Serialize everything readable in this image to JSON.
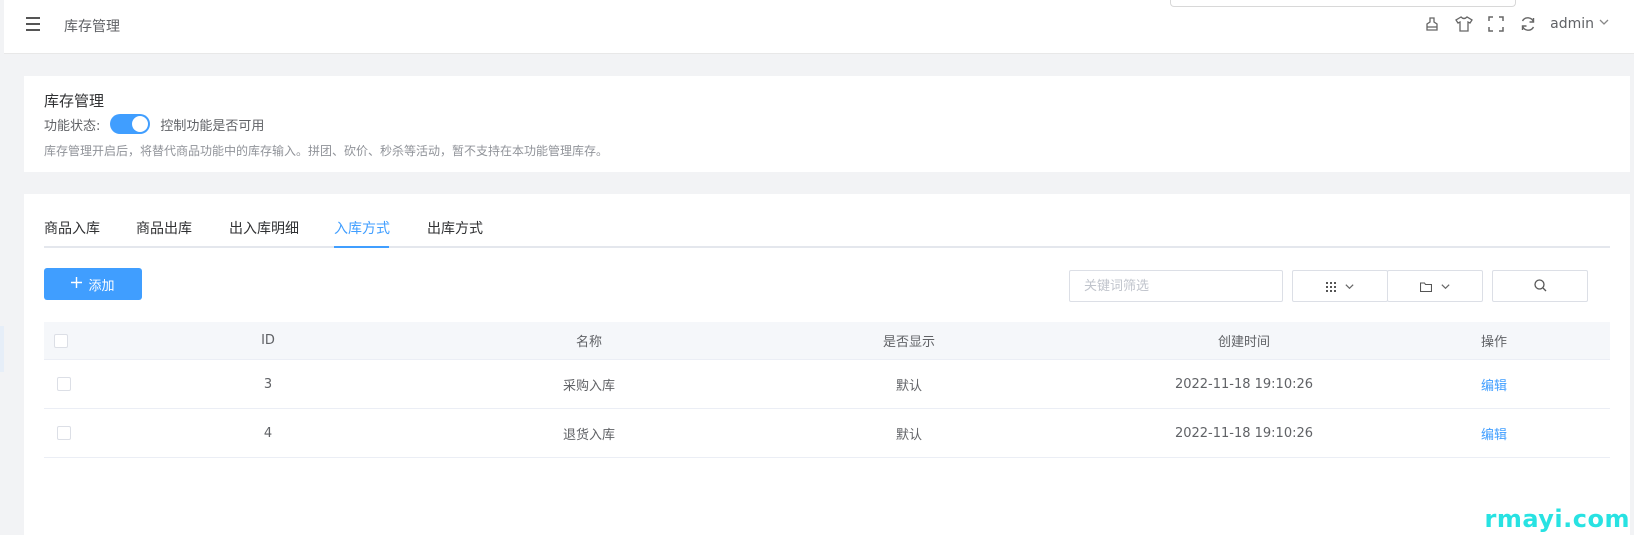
{
  "header": {
    "breadcrumb": "库存管理",
    "user": "admin",
    "icons": [
      "clean-icon",
      "shirt-icon",
      "fullscreen-icon",
      "refresh-icon",
      "chevron-down-icon"
    ]
  },
  "stock_card": {
    "title": "库存管理",
    "status_label": "功能状态:",
    "switch_on": true,
    "switch_desc": "控制功能是否可用",
    "note": "库存管理开启后，将替代商品功能中的库存输入。拼团、砍价、秒杀等活动，暂不支持在本功能管理库存。"
  },
  "tabs": [
    {
      "label": "商品入库",
      "active": false
    },
    {
      "label": "商品出库",
      "active": false
    },
    {
      "label": "出入库明细",
      "active": false
    },
    {
      "label": "入库方式",
      "active": true
    },
    {
      "label": "出库方式",
      "active": false
    }
  ],
  "toolbar": {
    "add_label": "添加",
    "search_placeholder": "关键词筛选"
  },
  "table": {
    "columns": [
      "ID",
      "名称",
      "是否显示",
      "创建时间",
      "操作"
    ],
    "rows": [
      {
        "id": "3",
        "name": "采购入库",
        "show": "默认",
        "created": "2022-11-18 19:10:26",
        "action": "编辑"
      },
      {
        "id": "4",
        "name": "退货入库",
        "show": "默认",
        "created": "2022-11-18 19:10:26",
        "action": "编辑"
      }
    ]
  },
  "watermark": "rmayi.com",
  "colors": {
    "primary": "#409eff",
    "background": "#f2f3f5",
    "watermark": "#28e2e2"
  }
}
